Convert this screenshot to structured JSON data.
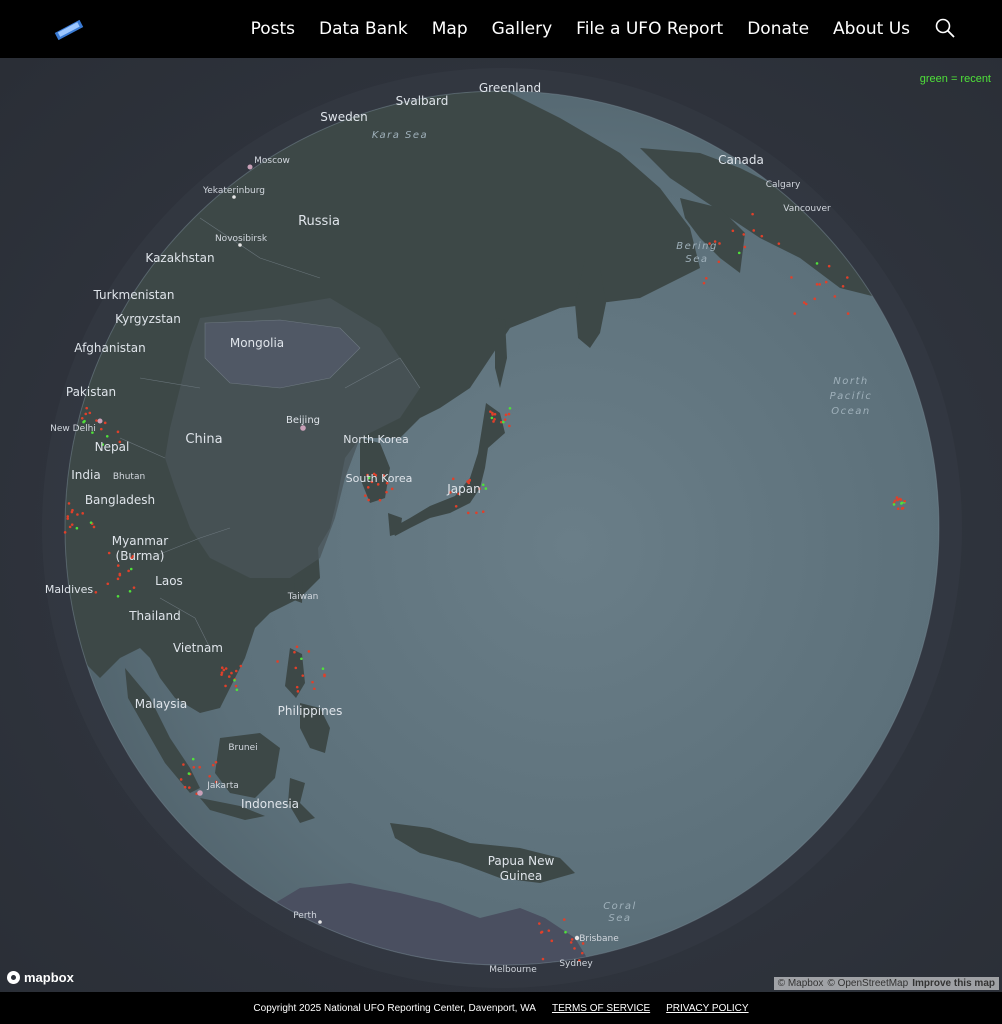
{
  "nav": {
    "items": [
      "Posts",
      "Data Bank",
      "Map",
      "Gallery",
      "File a UFO Report",
      "Donate",
      "About Us"
    ]
  },
  "map": {
    "legend_text": "green = recent",
    "countries": {
      "greenland": "Greenland",
      "svalbard": "Svalbard",
      "sweden": "Sweden",
      "russia": "Russia",
      "canada": "Canada",
      "kazakhstan": "Kazakhstan",
      "turkmenistan": "Turkmenistan",
      "kyrgyzstan": "Kyrgyzstan",
      "afghanistan": "Afghanistan",
      "mongolia": "Mongolia",
      "pakistan": "Pakistan",
      "nepal": "Nepal",
      "china": "China",
      "north_korea": "North Korea",
      "south_korea": "South Korea",
      "japan": "Japan",
      "india": "India",
      "bhutan": "Bhutan",
      "bangladesh": "Bangladesh",
      "myanmar_1": "Myanmar",
      "myanmar_2": "(Burma)",
      "laos": "Laos",
      "maldives": "Maldives",
      "taiwan": "Taiwan",
      "thailand": "Thailand",
      "vietnam": "Vietnam",
      "malaysia": "Malaysia",
      "philippines": "Philippines",
      "brunei": "Brunei",
      "indonesia": "Indonesia",
      "png_1": "Papua New",
      "png_2": "Guinea"
    },
    "cities": {
      "moscow": "Moscow",
      "yekaterinburg": "Yekaterinburg",
      "novosibirsk": "Novosibirsk",
      "calgary": "Calgary",
      "vancouver": "Vancouver",
      "new_delhi": "New Delhi",
      "beijing": "Beijing",
      "jakarta": "Jakarta",
      "perth": "Perth",
      "brisbane": "Brisbane",
      "sydney": "Sydney",
      "melbourne": "Melbourne"
    },
    "seas": {
      "kara_sea": "Kara Sea",
      "bering_1": "Bering",
      "bering_2": "Sea",
      "npo_1": "North",
      "npo_2": "Pacific",
      "npo_3": "Ocean",
      "coral_1": "Coral",
      "coral_2": "Sea"
    },
    "brand": "mapbox",
    "attribution": {
      "mapbox": "© Mapbox",
      "osm": "© OpenStreetMap",
      "improve": "Improve this map"
    },
    "colors": {
      "recent": "#4fe03a",
      "report": "#e0402a",
      "land": "#3f4a4a",
      "ocean": "#5f737c"
    }
  },
  "footer": {
    "copyright": "Copyright 2025 National UFO Reporting Center, Davenport, WA",
    "terms": "TERMS OF SERVICE",
    "privacy": "PRIVACY POLICY"
  }
}
